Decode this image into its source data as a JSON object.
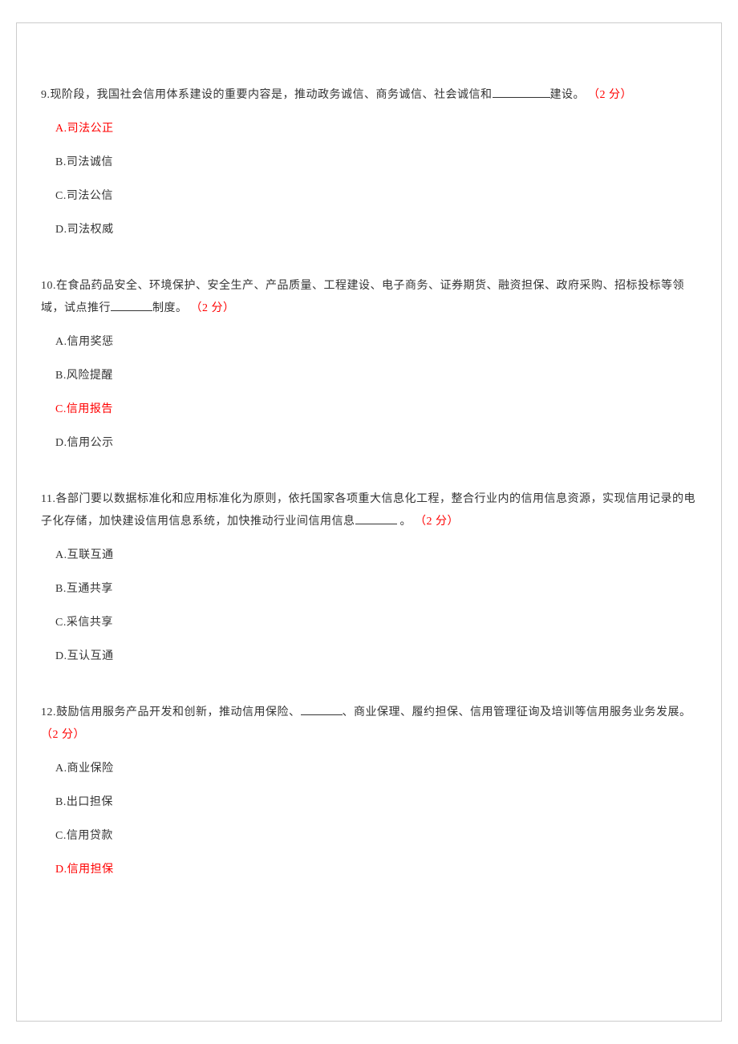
{
  "questions": [
    {
      "num": "9.",
      "pre": "现阶段，我国社会信用体系建设的重要内容是，推动政务诚信、商务诚信、社会诚信和",
      "blank_width": 72,
      "post": "建设。",
      "points": "（2 分）",
      "options": [
        {
          "label": "A.",
          "text": "司法公正",
          "hl": true
        },
        {
          "label": "B.",
          "text": "司法诚信",
          "hl": false
        },
        {
          "label": "C.",
          "text": "司法公信",
          "hl": false
        },
        {
          "label": "D.",
          "text": "司法权威",
          "hl": false
        }
      ]
    },
    {
      "num": "10.",
      "pre": "在食品药品安全、环境保护、安全生产、产品质量、工程建设、电子商务、证券期货、融资担保、政府采购、招标投标等领域，试点推行",
      "blank_width": 52,
      "post": "制度。",
      "points": "（2 分）",
      "options": [
        {
          "label": "A.",
          "text": "信用奖惩",
          "hl": false
        },
        {
          "label": "B.",
          "text": "风险提醒",
          "hl": false
        },
        {
          "label": "C.",
          "text": "信用报告",
          "hl": true
        },
        {
          "label": "D.",
          "text": "信用公示",
          "hl": false
        }
      ]
    },
    {
      "num": "11.",
      "pre": "各部门要以数据标准化和应用标准化为原则，依托国家各项重大信息化工程，整合行业内的信用信息资源，实现信用记录的电子化存储，加快建设信用信息系统，加快推动行业间信用信息",
      "blank_width": 52,
      "post": " 。",
      "points": "（2 分）",
      "options": [
        {
          "label": "A.",
          "text": "互联互通",
          "hl": false
        },
        {
          "label": "B.",
          "text": "互通共享",
          "hl": false
        },
        {
          "label": "C.",
          "text": "采信共享",
          "hl": false
        },
        {
          "label": "D.",
          "text": "互认互通",
          "hl": false
        }
      ]
    },
    {
      "num": "12.",
      "pre": "鼓励信用服务产品开发和创新，推动信用保险、",
      "blank_width": 52,
      "post": "、商业保理、履约担保、信用管理征询及培训等信用服务业务发展。",
      "points": "（2 分）",
      "options": [
        {
          "label": "A.",
          "text": "商业保险",
          "hl": false
        },
        {
          "label": "B.",
          "text": "出口担保",
          "hl": false
        },
        {
          "label": "C.",
          "text": "信用贷款",
          "hl": false
        },
        {
          "label": "D.",
          "text": "信用担保",
          "hl": true
        }
      ]
    }
  ]
}
